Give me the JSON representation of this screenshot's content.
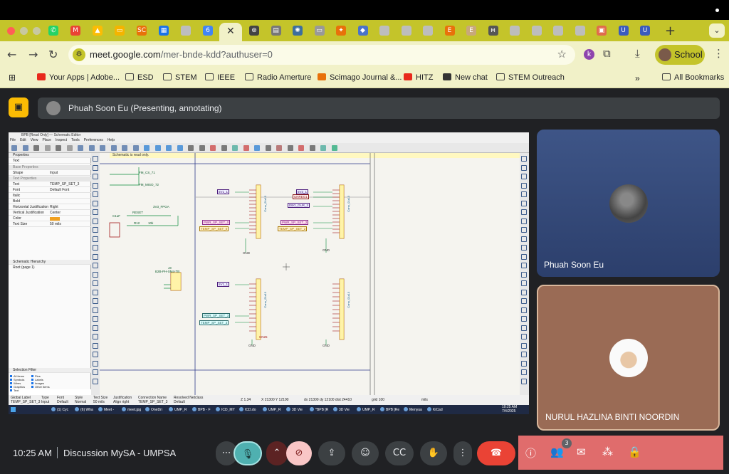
{
  "browser": {
    "url_host": "meet.google.com",
    "url_path": "/mer-bnde-kdd?authuser=0",
    "profile_label": "School",
    "extension_k_label": "k",
    "tab_favicons": [
      {
        "name": "whatsapp",
        "color": "#25d366",
        "glyph": "✆"
      },
      {
        "name": "gmail",
        "color": "#ea4335",
        "glyph": "M"
      },
      {
        "name": "drive",
        "color": "#fbbc04",
        "glyph": "▲"
      },
      {
        "name": "slides",
        "color": "#f4b400",
        "glyph": "▭"
      },
      {
        "name": "sc",
        "color": "#e8710a",
        "glyph": "SC"
      },
      {
        "name": "calendar",
        "color": "#1a73e8",
        "glyph": "▦"
      },
      {
        "name": "blank",
        "color": "#bdbdbd",
        "glyph": ""
      },
      {
        "name": "calendar6",
        "color": "#4285f4",
        "glyph": "6"
      }
    ],
    "tab_favicons_right": [
      {
        "name": "chatgpt",
        "color": "#444",
        "glyph": "⊛"
      },
      {
        "name": "doc",
        "color": "#777",
        "glyph": "▤"
      },
      {
        "name": "gear",
        "color": "#3c6e9f",
        "glyph": "✺"
      },
      {
        "name": "img",
        "color": "#999",
        "glyph": "▭"
      },
      {
        "name": "fox",
        "color": "#e8710a",
        "glyph": "✦"
      },
      {
        "name": "blue",
        "color": "#4a73c9",
        "glyph": "◆"
      },
      {
        "name": "grey1",
        "color": "#bdbdbd",
        "glyph": ""
      },
      {
        "name": "grey2",
        "color": "#bdbdbd",
        "glyph": ""
      },
      {
        "name": "grey3",
        "color": "#bdbdbd",
        "glyph": ""
      },
      {
        "name": "e1",
        "color": "#e8710a",
        "glyph": "E"
      },
      {
        "name": "e2",
        "color": "#c8a87a",
        "glyph": "E"
      },
      {
        "name": "m",
        "color": "#555",
        "glyph": "ᴍ"
      },
      {
        "name": "grey4",
        "color": "#bdbdbd",
        "glyph": ""
      },
      {
        "name": "grey5",
        "color": "#bdbdbd",
        "glyph": ""
      },
      {
        "name": "grey6",
        "color": "#bdbdbd",
        "glyph": ""
      },
      {
        "name": "grey7",
        "color": "#bdbdbd",
        "glyph": ""
      },
      {
        "name": "red",
        "color": "#e06c4c",
        "glyph": "▣"
      },
      {
        "name": "u1",
        "color": "#3b5bbd",
        "glyph": "U"
      },
      {
        "name": "u2",
        "color": "#3b5bbd",
        "glyph": "U"
      }
    ]
  },
  "bookmarks": [
    {
      "label": "Your Apps | Adobe...",
      "icon": "adobe-icon"
    },
    {
      "label": "ESD",
      "icon": "folder-icon"
    },
    {
      "label": "STEM",
      "icon": "folder-icon"
    },
    {
      "label": "IEEE",
      "icon": "folder-icon"
    },
    {
      "label": "Radio Amerture",
      "icon": "folder-icon"
    },
    {
      "label": "Scimago Journal &...",
      "icon": "scimago-icon"
    },
    {
      "label": "HITZ",
      "icon": "hitz-icon"
    },
    {
      "label": "New chat",
      "icon": "chatgpt-icon"
    },
    {
      "label": "STEM Outreach",
      "icon": "folder-icon"
    }
  ],
  "all_bookmarks_label": "All Bookmarks",
  "meet": {
    "presenter_label": "Phuah Soon Eu (Presenting, annotating)",
    "participants": [
      {
        "name": "Phuah Soon Eu"
      },
      {
        "name": "NURUL HAZLINA BINTI NOORDIN"
      }
    ],
    "time": "10:25 AM",
    "meeting_name": "Discussion MySA - UMPSA",
    "participant_count": "3"
  },
  "kicad": {
    "window_title": "BPB [Read Only] — Schematic Editor",
    "menu": [
      "File",
      "Edit",
      "View",
      "Place",
      "Inspect",
      "Tools",
      "Preferences",
      "Help"
    ],
    "banner": "Schematic is read only.",
    "properties_title": "Properties",
    "properties_subtitle": "Text",
    "base_props_header": "Base Properties",
    "text_props_header": "Text Properties",
    "props": [
      {
        "label": "Shape",
        "value": "Input"
      },
      {
        "label": "Text",
        "value": "TEMP_SP_SET_3"
      },
      {
        "label": "Font",
        "value": "Default Font"
      },
      {
        "label": "Italic",
        "value": ""
      },
      {
        "label": "Bold",
        "value": ""
      },
      {
        "label": "Horizontal Justification",
        "value": "Right"
      },
      {
        "label": "Vertical Justification",
        "value": "Center"
      },
      {
        "label": "Color",
        "value": ""
      },
      {
        "label": "Text Size",
        "value": "50 mils"
      }
    ],
    "hierarchy_title": "Schematic Hierarchy",
    "hierarchy_root": "Root (page 1)",
    "selection_title": "Selection Filter",
    "filters": [
      "All items",
      "Pins",
      "Symbols",
      "Labels",
      "Wires",
      "Images",
      "Graphics",
      "Other items",
      "Text"
    ],
    "status": {
      "h1": "Global Label",
      "v1": "TEMP_SP_SET_3",
      "h2": "Type",
      "v2": "Input",
      "h3": "Font",
      "v3": "Default",
      "h4": "Style",
      "v4": "Normal",
      "h5": "Text Size",
      "v5": "50 mils",
      "h6": "Justification",
      "v6": "Align right",
      "h7": "Connection Name",
      "v7": "TEMP_SP_SET_3",
      "h8": "Resolved Netclass",
      "v8": "Default",
      "zoom": "Z 1.34",
      "xy": "X 21300  Y 12100",
      "dxy": "dx 21300  dy 12100  dist 24410",
      "grid": "grid 100",
      "units": "mils"
    },
    "net_labels": {
      "fm_cs": "FM_CS_71",
      "fm_miso": "FM_MISO_72",
      "v33_fpga": "3V3_FPGA",
      "reset": "RESET",
      "c_label": "C1uF",
      "r_label": "R12",
      "r_val": "10k",
      "j_label": "J3",
      "j_val": "B2B-PH-SM4-TB",
      "l_5v1": "5V1_1",
      "l_pwr0": "PWR_SP_SET_0",
      "l_temp0": "TEMP_SP_SET_0",
      "l_5v1b": "5V3_1",
      "l_unreg": "UNREG1",
      "l_dbg": "DBG_DUR_3",
      "l_pwr2": "PWR_SP_SET_2",
      "l_temp2": "TEMP_SP_SET_2",
      "l_5v1c": "5V1_1",
      "l_pwr3": "PWR_SP_SET_3",
      "l_temp3": "TEMP_SP_SET_3",
      "gnd": "GND",
      "cn25": "CN25",
      "conn_name": "Conn_01x13"
    },
    "taskbar": [
      "(1) Cyc",
      "(6) Wha",
      "Meet -",
      "meet.jpg",
      "OneDri",
      "UMP_R",
      "BPB - F",
      "ICD_MY",
      "ICD.do",
      "UMP_R",
      "3D Vie",
      "*BPB [R",
      "3D Vie",
      "UMP_R",
      "BPB [Re",
      "Menyua",
      "KiCad"
    ],
    "taskbar_time": "10:25 AM",
    "taskbar_date": "7/4/2025"
  }
}
